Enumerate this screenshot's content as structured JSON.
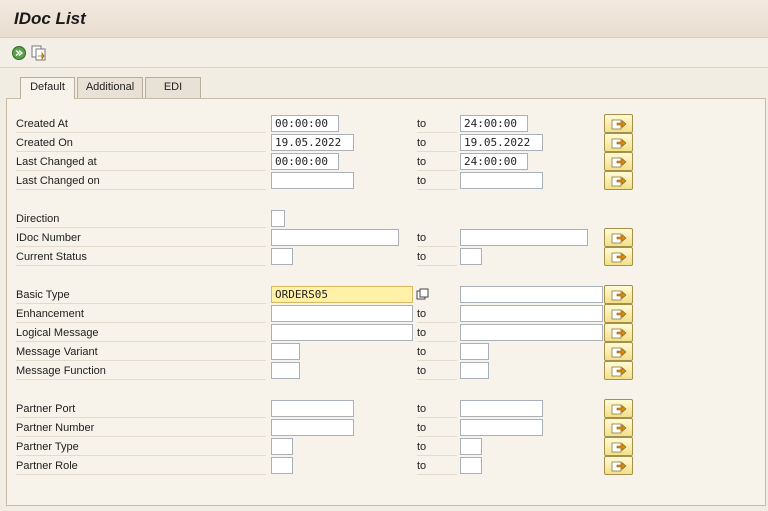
{
  "window": {
    "title": "IDoc List"
  },
  "toolbar": {
    "execute_icon": "execute-icon",
    "variant_icon": "get-variant-icon"
  },
  "tabs": [
    {
      "label": "Default",
      "active": true
    },
    {
      "label": "Additional",
      "active": false
    },
    {
      "label": "EDI",
      "active": false
    }
  ],
  "to_label": "to",
  "fields": {
    "created_at": {
      "label": "Created At",
      "from": "00:00:00",
      "to": "24:00:00"
    },
    "created_on": {
      "label": "Created On",
      "from": "19.05.2022",
      "to": "19.05.2022"
    },
    "last_changed_at": {
      "label": "Last Changed at",
      "from": "00:00:00",
      "to": "24:00:00"
    },
    "last_changed_on": {
      "label": "Last Changed on",
      "from": "",
      "to": ""
    },
    "direction": {
      "label": "Direction",
      "from": ""
    },
    "idoc_number": {
      "label": "IDoc Number",
      "from": "",
      "to": ""
    },
    "current_status": {
      "label": "Current Status",
      "from": "",
      "to": ""
    },
    "basic_type": {
      "label": "Basic Type",
      "from": "ORDERS05",
      "to": ""
    },
    "enhancement": {
      "label": "Enhancement",
      "from": "",
      "to": ""
    },
    "logical_message": {
      "label": "Logical Message",
      "from": "",
      "to": ""
    },
    "message_variant": {
      "label": "Message Variant",
      "from": "",
      "to": ""
    },
    "message_function": {
      "label": "Message Function",
      "from": "",
      "to": ""
    },
    "partner_port": {
      "label": "Partner Port",
      "from": "",
      "to": ""
    },
    "partner_number": {
      "label": "Partner Number",
      "from": "",
      "to": ""
    },
    "partner_type": {
      "label": "Partner Type",
      "from": "",
      "to": ""
    },
    "partner_role": {
      "label": "Partner Role",
      "from": "",
      "to": ""
    }
  },
  "colors": {
    "focus_field": "#fff2a8",
    "multi_select_button": "#f3e08a",
    "background": "#f1ede2"
  }
}
